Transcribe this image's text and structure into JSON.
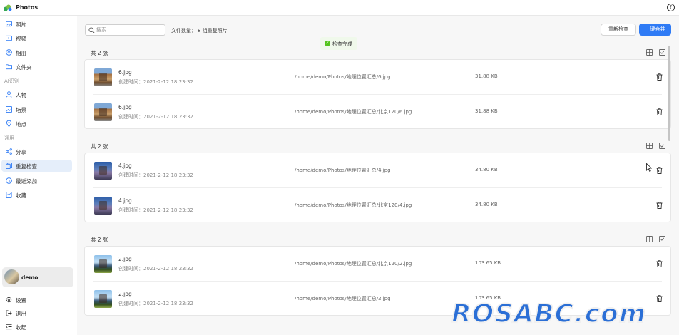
{
  "app": {
    "title": "Photos",
    "help": "?"
  },
  "sidebar": {
    "items": [
      {
        "label": "照片",
        "icon": "photo-icon"
      },
      {
        "label": "视频",
        "icon": "video-icon"
      },
      {
        "label": "相册",
        "icon": "album-icon"
      },
      {
        "label": "文件夹",
        "icon": "folder-icon"
      }
    ],
    "ai_section": "AI识别",
    "ai_items": [
      {
        "label": "人物",
        "icon": "person-icon"
      },
      {
        "label": "场景",
        "icon": "scene-icon"
      },
      {
        "label": "地点",
        "icon": "location-icon"
      }
    ],
    "general_section": "通用",
    "general_items": [
      {
        "label": "分享",
        "icon": "share-icon"
      },
      {
        "label": "重复检查",
        "icon": "duplicate-icon",
        "active": true
      },
      {
        "label": "最近添加",
        "icon": "clock-icon"
      },
      {
        "label": "收藏",
        "icon": "favorite-icon"
      }
    ],
    "user": {
      "name": "demo"
    },
    "bottom_items": [
      {
        "label": "设置",
        "icon": "settings-icon"
      },
      {
        "label": "退出",
        "icon": "logout-icon"
      },
      {
        "label": "收起",
        "icon": "collapse-icon"
      }
    ]
  },
  "toolbar": {
    "search_placeholder": "搜索",
    "file_count_label": "文件数量：",
    "file_count_value": "8 组重复照片",
    "rescan_label": "重新检查",
    "merge_label": "一键合并"
  },
  "toast": {
    "text": "检查完成"
  },
  "groups": [
    {
      "header": "共 2 张",
      "files": [
        {
          "name": "6.jpg",
          "created": "创建时间：2021-2-12 18:23:32",
          "path": "/home/demo/Photos/地理位置汇总/6.jpg",
          "size": "31.88 KB"
        },
        {
          "name": "6.jpg",
          "created": "创建时间：2021-2-12 18:23:32",
          "path": "/home/demo/Photos/地理位置汇总/北京120/6.jpg",
          "size": "31.88 KB"
        }
      ]
    },
    {
      "header": "共 2 张",
      "files": [
        {
          "name": "4.jpg",
          "created": "创建时间：2021-2-12 18:23:32",
          "path": "/home/demo/Photos/地理位置汇总/4.jpg",
          "size": "34.80 KB"
        },
        {
          "name": "4.jpg",
          "created": "创建时间：2021-2-12 18:23:32",
          "path": "/home/demo/Photos/地理位置汇总/北京120/4.jpg",
          "size": "34.80 KB"
        }
      ]
    },
    {
      "header": "共 2 张",
      "files": [
        {
          "name": "2.jpg",
          "created": "创建时间：2021-2-12 18:23:32",
          "path": "/home/demo/Photos/地理位置汇总/北京120/2.jpg",
          "size": "103.65 KB"
        },
        {
          "name": "2.jpg",
          "created": "创建时间：2021-2-12 18:23:32",
          "path": "/home/demo/Photos/地理位置汇总/2.jpg",
          "size": "103.65 KB"
        }
      ]
    }
  ],
  "watermark": "ROSABC.com",
  "colors": {
    "accent": "#2f7bf5",
    "active_bg": "#e5eefa",
    "success": "#52c41a"
  }
}
